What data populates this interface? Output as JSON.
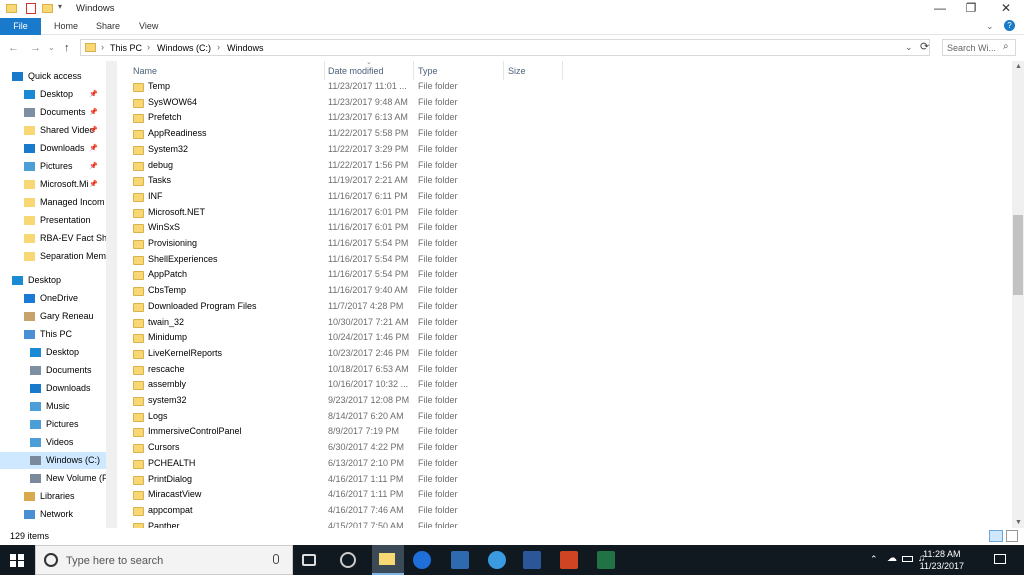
{
  "title": "Windows",
  "ribbon": {
    "file": "File",
    "home": "Home",
    "share": "Share",
    "view": "View"
  },
  "path": {
    "this_pc": "This PC",
    "drive": "Windows (C:)",
    "folder": "Windows"
  },
  "search": {
    "placeholder": "Search Wi..."
  },
  "nav": [
    {
      "label": "Quick access",
      "icon": "star-icon",
      "pinned": false
    },
    {
      "label": "Desktop",
      "icon": "desktop-icon",
      "pinned": true
    },
    {
      "label": "Documents",
      "icon": "documents-icon",
      "pinned": true
    },
    {
      "label": "Shared Video",
      "icon": "folder-icon",
      "pinned": true
    },
    {
      "label": "Downloads",
      "icon": "download-icon",
      "pinned": true
    },
    {
      "label": "Pictures",
      "icon": "pictures-icon",
      "pinned": true
    },
    {
      "label": "Microsoft.Mi",
      "icon": "folder-icon",
      "pinned": true
    },
    {
      "label": "Managed Incom",
      "icon": "folder-icon",
      "pinned": false
    },
    {
      "label": "Presentation",
      "icon": "folder-icon",
      "pinned": false
    },
    {
      "label": "RBA-EV Fact She",
      "icon": "folder-icon",
      "pinned": false
    },
    {
      "label": "Separation Mem",
      "icon": "folder-icon",
      "pinned": false
    },
    {
      "label": "Desktop",
      "icon": "desktop-icon",
      "pinned": false
    },
    {
      "label": "OneDrive",
      "icon": "cloud-icon",
      "pinned": false
    },
    {
      "label": "Gary Reneau",
      "icon": "user-icon",
      "pinned": false
    },
    {
      "label": "This PC",
      "icon": "computer-icon",
      "pinned": false
    },
    {
      "label": "Desktop",
      "icon": "desktop-icon",
      "pinned": false
    },
    {
      "label": "Documents",
      "icon": "documents-icon",
      "pinned": false
    },
    {
      "label": "Downloads",
      "icon": "download-icon",
      "pinned": false
    },
    {
      "label": "Music",
      "icon": "music-icon",
      "pinned": false
    },
    {
      "label": "Pictures",
      "icon": "pictures-icon",
      "pinned": false
    },
    {
      "label": "Videos",
      "icon": "videos-icon",
      "pinned": false
    },
    {
      "label": "Windows (C:)",
      "icon": "drive-icon",
      "pinned": false
    },
    {
      "label": "New Volume (F",
      "icon": "drive-icon",
      "pinned": false
    },
    {
      "label": "Libraries",
      "icon": "libraries-icon",
      "pinned": false
    },
    {
      "label": "Network",
      "icon": "network-icon",
      "pinned": false
    }
  ],
  "columns": {
    "name": "Name",
    "date": "Date modified",
    "type": "Type",
    "size": "Size"
  },
  "files": [
    {
      "name": "Temp",
      "date": "11/23/2017 11:01 ...",
      "type": "File folder"
    },
    {
      "name": "SysWOW64",
      "date": "11/23/2017 9:48 AM",
      "type": "File folder"
    },
    {
      "name": "Prefetch",
      "date": "11/23/2017 6:13 AM",
      "type": "File folder"
    },
    {
      "name": "AppReadiness",
      "date": "11/22/2017 5:58 PM",
      "type": "File folder"
    },
    {
      "name": "System32",
      "date": "11/22/2017 3:29 PM",
      "type": "File folder"
    },
    {
      "name": "debug",
      "date": "11/22/2017 1:56 PM",
      "type": "File folder"
    },
    {
      "name": "Tasks",
      "date": "11/19/2017 2:21 AM",
      "type": "File folder"
    },
    {
      "name": "INF",
      "date": "11/16/2017 6:11 PM",
      "type": "File folder"
    },
    {
      "name": "Microsoft.NET",
      "date": "11/16/2017 6:01 PM",
      "type": "File folder"
    },
    {
      "name": "WinSxS",
      "date": "11/16/2017 6:01 PM",
      "type": "File folder"
    },
    {
      "name": "Provisioning",
      "date": "11/16/2017 5:54 PM",
      "type": "File folder"
    },
    {
      "name": "ShellExperiences",
      "date": "11/16/2017 5:54 PM",
      "type": "File folder"
    },
    {
      "name": "AppPatch",
      "date": "11/16/2017 5:54 PM",
      "type": "File folder"
    },
    {
      "name": "CbsTemp",
      "date": "11/16/2017 9:40 AM",
      "type": "File folder"
    },
    {
      "name": "Downloaded Program Files",
      "date": "11/7/2017 4:28 PM",
      "type": "File folder"
    },
    {
      "name": "twain_32",
      "date": "10/30/2017 7:21 AM",
      "type": "File folder"
    },
    {
      "name": "Minidump",
      "date": "10/24/2017 1:46 PM",
      "type": "File folder"
    },
    {
      "name": "LiveKernelReports",
      "date": "10/23/2017 2:46 PM",
      "type": "File folder"
    },
    {
      "name": "rescache",
      "date": "10/18/2017 6:53 AM",
      "type": "File folder"
    },
    {
      "name": "assembly",
      "date": "10/16/2017 10:32 ...",
      "type": "File folder"
    },
    {
      "name": "system32",
      "date": "9/23/2017 12:08 PM",
      "type": "File folder"
    },
    {
      "name": "Logs",
      "date": "8/14/2017 6:20 AM",
      "type": "File folder"
    },
    {
      "name": "ImmersiveControlPanel",
      "date": "8/9/2017 7:19 PM",
      "type": "File folder"
    },
    {
      "name": "Cursors",
      "date": "6/30/2017 4:22 PM",
      "type": "File folder"
    },
    {
      "name": "PCHEALTH",
      "date": "6/13/2017 2:10 PM",
      "type": "File folder"
    },
    {
      "name": "PrintDialog",
      "date": "4/16/2017 1:11 PM",
      "type": "File folder"
    },
    {
      "name": "MiracastView",
      "date": "4/16/2017 1:11 PM",
      "type": "File folder"
    },
    {
      "name": "appcompat",
      "date": "4/16/2017 7:46 AM",
      "type": "File folder"
    },
    {
      "name": "Panther",
      "date": "4/15/2017 7:50 AM",
      "type": "File folder"
    }
  ],
  "status": {
    "count": "129 items"
  },
  "taskbar": {
    "search_placeholder": "Type here to search",
    "time": "11:28 AM",
    "date": "11/23/2017"
  },
  "colors": {
    "accent": "#1979ca",
    "folder": "#f8d775",
    "selected": "#cde8ff",
    "taskbar": "#101820"
  }
}
